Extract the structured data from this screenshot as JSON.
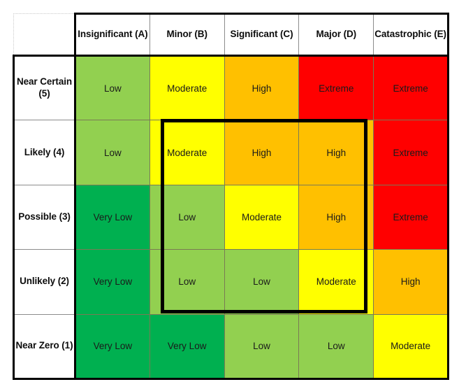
{
  "matrix": {
    "corner_label": "",
    "severity_headers": [
      "Insignificant (A)",
      "Minor (B)",
      "Significant (C)",
      "Major (D)",
      "Catastrophic (E)"
    ],
    "likelihood_headers": [
      "Near Certain (5)",
      "Likely (4)",
      "Possible (3)",
      "Unlikely (2)",
      "Near Zero (1)"
    ],
    "rows": [
      {
        "likelihood": "Near Certain (5)",
        "cells": [
          {
            "label": "Low",
            "color": "#92D050"
          },
          {
            "label": "Moderate",
            "color": "#FFFF00"
          },
          {
            "label": "High",
            "color": "#FFC000"
          },
          {
            "label": "Extreme",
            "color": "#FF0000"
          },
          {
            "label": "Extreme",
            "color": "#FF0000"
          }
        ]
      },
      {
        "likelihood": "Likely (4)",
        "cells": [
          {
            "label": "Low",
            "color": "#92D050"
          },
          {
            "label": "Moderate",
            "color": "#FFFF00"
          },
          {
            "label": "High",
            "color": "#FFC000"
          },
          {
            "label": "High",
            "color": "#FFC000"
          },
          {
            "label": "Extreme",
            "color": "#FF0000"
          }
        ]
      },
      {
        "likelihood": "Possible (3)",
        "cells": [
          {
            "label": "Very Low",
            "color": "#00B050"
          },
          {
            "label": "Low",
            "color": "#92D050"
          },
          {
            "label": "Moderate",
            "color": "#FFFF00"
          },
          {
            "label": "High",
            "color": "#FFC000"
          },
          {
            "label": "Extreme",
            "color": "#FF0000"
          }
        ]
      },
      {
        "likelihood": "Unlikely (2)",
        "cells": [
          {
            "label": "Very Low",
            "color": "#00B050"
          },
          {
            "label": "Low",
            "color": "#92D050"
          },
          {
            "label": "Low",
            "color": "#92D050"
          },
          {
            "label": "Moderate",
            "color": "#FFFF00"
          },
          {
            "label": "High",
            "color": "#FFC000"
          }
        ]
      },
      {
        "likelihood": "Near Zero (1)",
        "cells": [
          {
            "label": "Very Low",
            "color": "#00B050"
          },
          {
            "label": "Very Low",
            "color": "#00B050"
          },
          {
            "label": "Low",
            "color": "#92D050"
          },
          {
            "label": "Low",
            "color": "#92D050"
          },
          {
            "label": "Moderate",
            "color": "#FFFF00"
          }
        ]
      }
    ],
    "highlight": {
      "name": "risk-appetite-boundary",
      "columns": [
        "Minor (B)",
        "Significant (C)",
        "Major (D)"
      ],
      "rows": [
        "Likely (4)",
        "Possible (3)",
        "Unlikely (2)"
      ],
      "border_color": "#000000"
    },
    "legend_colors": {
      "very_low": "#00B050",
      "low": "#92D050",
      "moderate": "#FFFF00",
      "high": "#FFC000",
      "extreme": "#FF0000"
    }
  },
  "chart_data": {
    "type": "heatmap",
    "title": "",
    "xlabel": "",
    "ylabel": "",
    "x_categories": [
      "Insignificant (A)",
      "Minor (B)",
      "Significant (C)",
      "Major (D)",
      "Catastrophic (E)"
    ],
    "y_categories": [
      "Near Certain (5)",
      "Likely (4)",
      "Possible (3)",
      "Unlikely (2)",
      "Near Zero (1)"
    ],
    "cell_labels": [
      [
        "Low",
        "Moderate",
        "High",
        "Extreme",
        "Extreme"
      ],
      [
        "Low",
        "Moderate",
        "High",
        "High",
        "Extreme"
      ],
      [
        "Very Low",
        "Low",
        "Moderate",
        "High",
        "Extreme"
      ],
      [
        "Very Low",
        "Low",
        "Low",
        "Moderate",
        "High"
      ],
      [
        "Very Low",
        "Very Low",
        "Low",
        "Low",
        "Moderate"
      ]
    ],
    "cell_colors": [
      [
        "#92D050",
        "#FFFF00",
        "#FFC000",
        "#FF0000",
        "#FF0000"
      ],
      [
        "#92D050",
        "#FFFF00",
        "#FFC000",
        "#FFC000",
        "#FF0000"
      ],
      [
        "#00B050",
        "#92D050",
        "#FFFF00",
        "#FFC000",
        "#FF0000"
      ],
      [
        "#00B050",
        "#92D050",
        "#92D050",
        "#FFFF00",
        "#FFC000"
      ],
      [
        "#00B050",
        "#00B050",
        "#92D050",
        "#92D050",
        "#FFFF00"
      ]
    ],
    "severity_scale": [
      "Very Low",
      "Low",
      "Moderate",
      "High",
      "Extreme"
    ],
    "grid": true,
    "legend_position": "none"
  }
}
